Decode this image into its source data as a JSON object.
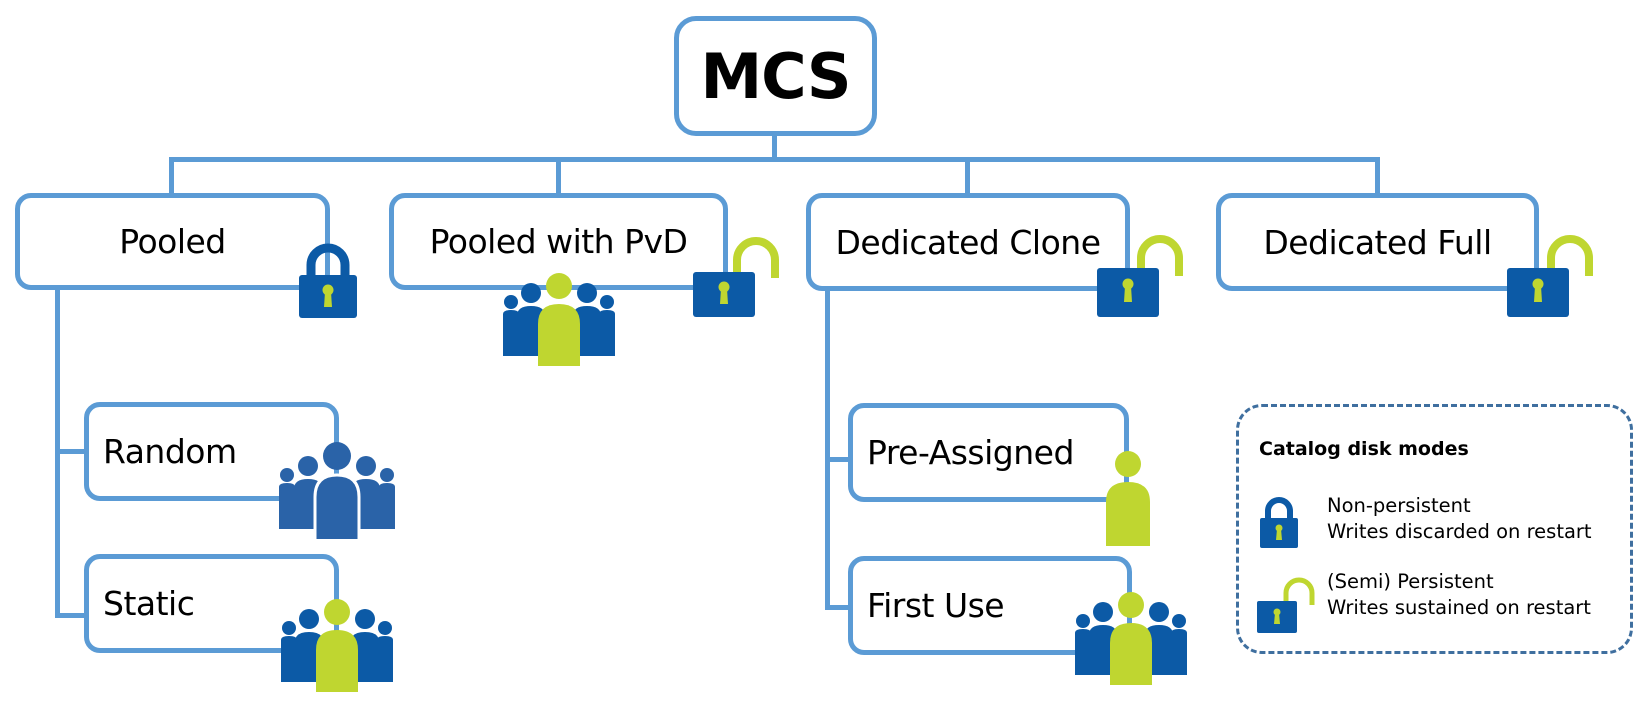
{
  "diagram": {
    "root": {
      "label": "MCS"
    },
    "catalog_types": [
      {
        "label": "Pooled",
        "disk_mode": "non-persistent"
      },
      {
        "label": "Pooled with PvD",
        "disk_mode": "semi-persistent",
        "users": "shared-crowd"
      },
      {
        "label": "Dedicated Clone",
        "disk_mode": "semi-persistent"
      },
      {
        "label": "Dedicated Full",
        "disk_mode": "semi-persistent"
      }
    ],
    "pooled_children": [
      {
        "label": "Random",
        "users": "crowd"
      },
      {
        "label": "Static",
        "users": "assigned-in-crowd"
      }
    ],
    "dedicated_clone_children": [
      {
        "label": "Pre-Assigned",
        "users": "single-user"
      },
      {
        "label": "First Use",
        "users": "assigned-in-crowd"
      }
    ]
  },
  "legend": {
    "title": "Catalog disk modes",
    "items": [
      {
        "icon": "closed-lock-icon",
        "line1": "Non-persistent",
        "line2": "Writes discarded on restart"
      },
      {
        "icon": "open-lock-icon",
        "line1": "(Semi) Persistent",
        "line2": "Writes sustained on restart"
      }
    ]
  },
  "colors": {
    "connector": "#5b9bd5",
    "lock_body": "#0c5aa6",
    "accent_green": "#bfd630",
    "crowd_blue": "#0c5aa6",
    "crowd_random": "#2a63a8",
    "legend_border": "#3f6f9f"
  }
}
